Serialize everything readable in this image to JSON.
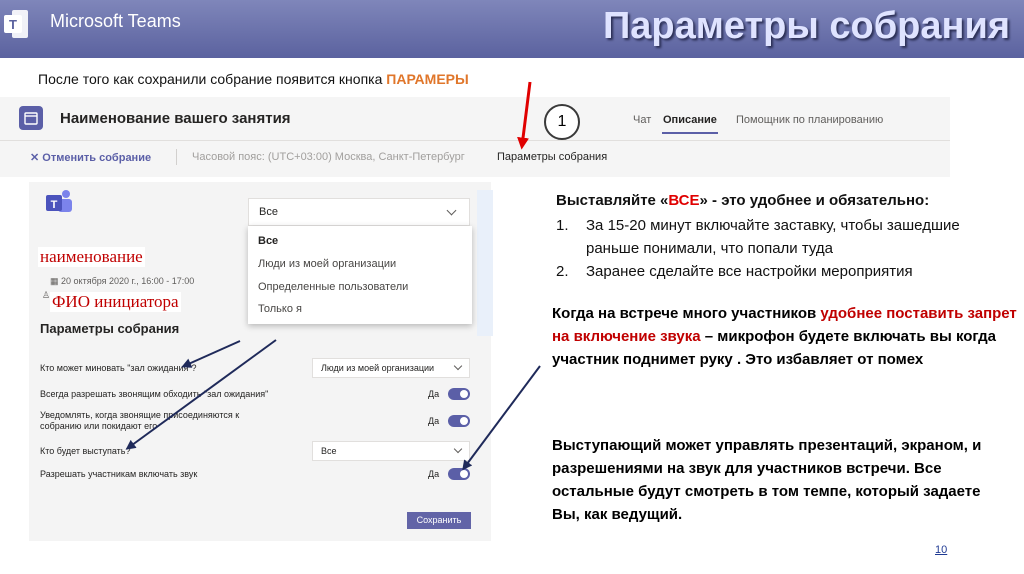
{
  "app": {
    "name": "Microsoft Teams"
  },
  "slide": {
    "title": "Параметры собрания",
    "subtitle_prefix": "После того как сохранили собрание появится кнопка ",
    "subtitle_highlight": "ПАРАМЕРЫ",
    "page_number": "10"
  },
  "meeting_bar": {
    "name": "Наименование вашего занятия",
    "tabs": [
      "Чат",
      "Описание",
      "Помощник по планированию"
    ],
    "active_tab": "Описание",
    "cancel_label": "Отменить собрание",
    "timezone": "Часовой пояс: (UTC+03:00) Москва, Санкт-Петербург",
    "options_link": "Параметры собрания",
    "badge": "1"
  },
  "options_panel": {
    "dropdown": {
      "selected": "Все",
      "options": [
        "Все",
        "Люди из моей организации",
        "Определенные пользователи",
        "Только я"
      ]
    },
    "label_name": "наименование",
    "date": "20 октября 2020 г., 16:00 - 17:00",
    "label_initiator": "ФИО инициатора",
    "title": "Параметры собрания",
    "rows": {
      "lobby_label": "Кто может миновать \"зал ожидания\"?",
      "lobby_value": "Люди из моей организации",
      "callers_label": "Всегда разрешать звонящим обходить \"зал ожидания\"",
      "callers_value": "Да",
      "notify_label_1": "Уведомлять, когда звонящие присоединяются к",
      "notify_label_2": "собранию или покидают его",
      "notify_value": "Да",
      "presenters_label": "Кто будет выступать?",
      "presenters_value": "Все",
      "unmute_label": "Разрешать участникам включать звук",
      "unmute_value": "Да"
    },
    "save_label": "Сохранить"
  },
  "notes": {
    "heading_prefix": "Выставляйте «",
    "heading_highlight": "ВСЕ",
    "heading_suffix": "» - это удобнее и обязательно:",
    "list": [
      {
        "num": "1.",
        "text": "За 15-20 минут включайте заставку, чтобы зашедшие раньше понимали, что попали туда"
      },
      {
        "num": "2.",
        "text": "Заранее сделайте все настройки мероприятия"
      }
    ],
    "block2_prefix": "Когда на встрече много участников ",
    "block2_highlight": "удобнее поставить запрет на включение звука",
    "block2_suffix": " – микрофон будете включать вы когда участник поднимет руку . Это избавляет от помех",
    "block3": "Выступающий может управлять презентаций, экраном, и разрешениями на звук для участников встречи. Все остальные будут смотреть в том темпе, который задаете Вы, как ведущий."
  },
  "colors": {
    "header": "#5b629f",
    "teams_purple": "#5b5fa7",
    "highlight_orange": "#e0762a",
    "highlight_red": "#e00000",
    "arrow_red": "#e00000",
    "arrow_navy": "#1f2a5a"
  }
}
